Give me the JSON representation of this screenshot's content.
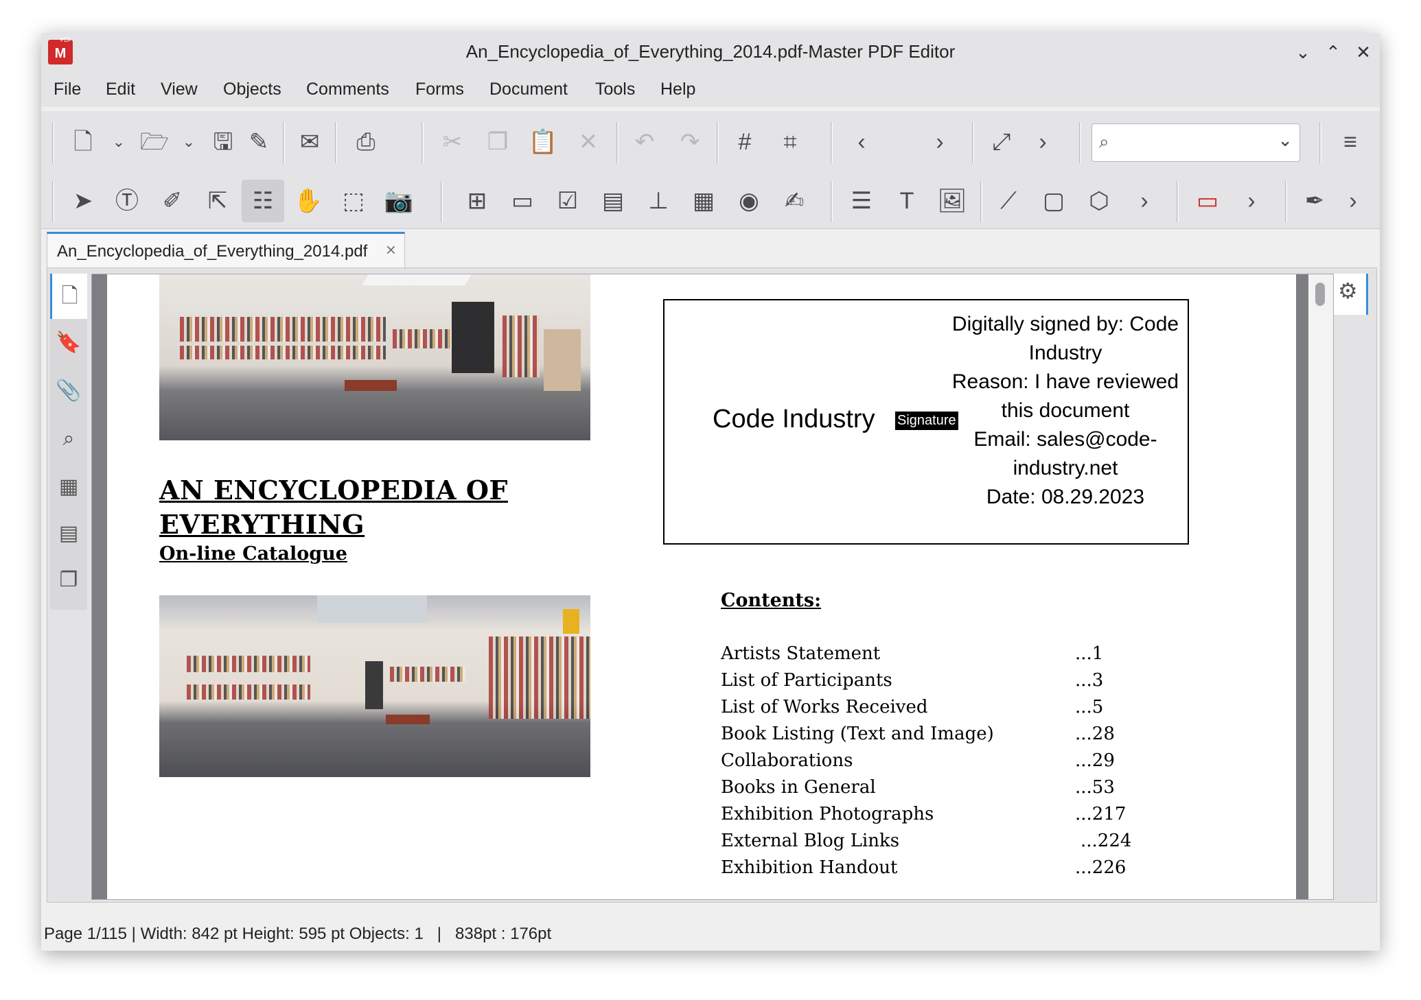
{
  "window": {
    "title": "An_Encyclopedia_of_Everything_2014.pdf-Master PDF Editor",
    "logo_badge": "PDF"
  },
  "menu": [
    "File",
    "Edit",
    "View",
    "Objects",
    "Comments",
    "Forms",
    "Document",
    "Tools",
    "Help"
  ],
  "search": {
    "value": "",
    "placeholder": ""
  },
  "tab": {
    "label": "An_Encyclopedia_of_Everything_2014.pdf"
  },
  "document": {
    "title": "AN ENCYCLOPEDIA OF EVERYTHING",
    "subtitle": "On-line Catalogue",
    "signature": {
      "name": "Code Industry",
      "badge": "Signature",
      "details": [
        "Digitally signed by: Code Industry",
        "Reason: I have reviewed this document",
        "Email: sales@code-industry.net",
        "Date: 08.29.2023"
      ]
    },
    "contents_heading": "Contents:",
    "toc": [
      {
        "title": "Artists Statement",
        "page": "...1"
      },
      {
        "title": "List of Participants",
        "page": "...3"
      },
      {
        "title": "List of Works Received",
        "page": "...5"
      },
      {
        "title": "Book Listing (Text and Image)",
        "page": "...28"
      },
      {
        "title": "Collaborations",
        "page": "...29"
      },
      {
        "title": "Books in General",
        "page": "...53"
      },
      {
        "title": "Exhibition Photographs",
        "page": "...217"
      },
      {
        "title": "External Blog Links",
        "page": "...224"
      },
      {
        "title": "Exhibition Handout",
        "page": "...226"
      }
    ]
  },
  "status": {
    "text": "Page 1/115 | Width: 842 pt Height: 595 pt Objects: 1   |   838pt : 176pt"
  }
}
